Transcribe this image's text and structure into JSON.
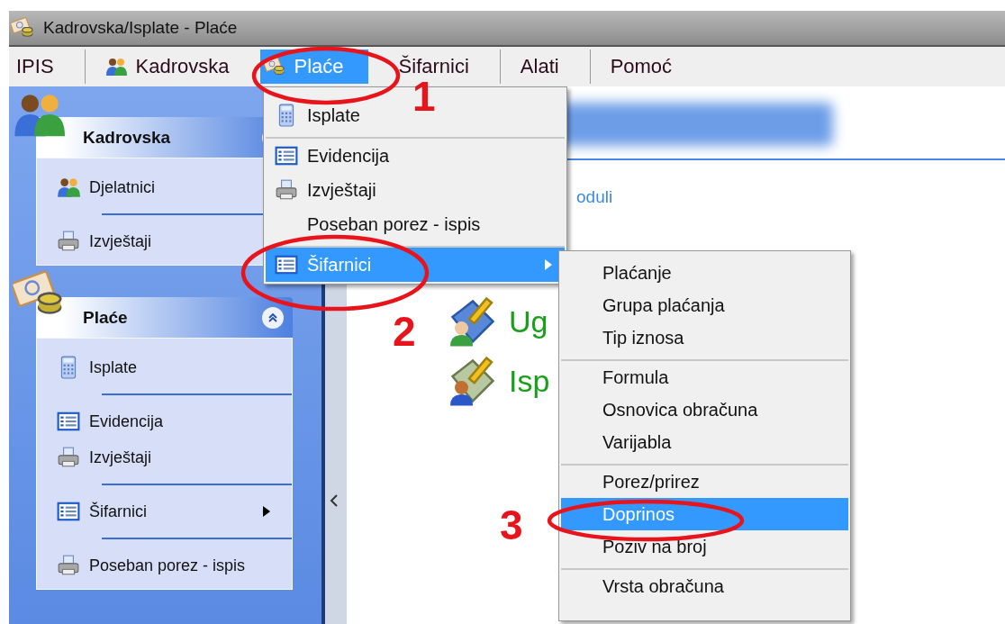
{
  "window": {
    "title": "Kadrovska/Isplate - Plaće"
  },
  "menu_bar": [
    {
      "label": "IPIS",
      "kind": "none",
      "selected": false,
      "separator_before": false
    },
    {
      "label": "Kadrovska",
      "kind": "people",
      "selected": false,
      "separator_before": true
    },
    {
      "label": "Plaće",
      "kind": "money",
      "selected": true,
      "separator_before": false
    },
    {
      "label": "Šifarnici",
      "kind": "none",
      "selected": false,
      "separator_before": false
    },
    {
      "label": "Alati",
      "kind": "none",
      "selected": false,
      "separator_before": true
    },
    {
      "label": "Pomoć",
      "kind": "none",
      "selected": false,
      "separator_before": true
    }
  ],
  "sidebar": {
    "groups": [
      {
        "title": "Kadrovska",
        "kind": "people",
        "expanded": true,
        "items": [
          {
            "label": "Djelatnici",
            "kind": "people",
            "separator_before": false
          },
          {
            "label": "Izvještaji",
            "kind": "printer",
            "separator_before": true
          }
        ]
      },
      {
        "title": "Plaće",
        "kind": "money",
        "expanded": true,
        "items": [
          {
            "label": "Isplate",
            "kind": "calculator",
            "separator_before": false,
            "has_submenu": false
          },
          {
            "label": "Evidencija",
            "kind": "list",
            "separator_before": true,
            "has_submenu": false
          },
          {
            "label": "Izvještaji",
            "kind": "printer",
            "separator_before": false,
            "has_submenu": false
          },
          {
            "label": "Šifarnici",
            "kind": "list",
            "separator_before": true,
            "has_submenu": true
          },
          {
            "label": "Poseban porez - ispis",
            "kind": "printer",
            "separator_before": true,
            "has_submenu": false
          }
        ]
      }
    ]
  },
  "main": {
    "link": "oduli",
    "entries": [
      {
        "label": "Ug",
        "kind": "folder"
      },
      {
        "label": "Isp",
        "kind": "banknote"
      }
    ]
  },
  "dropdown_menu": {
    "items": [
      {
        "label": "Isplate",
        "kind": "calculator",
        "selected": false,
        "separator_before": false,
        "has_submenu": false
      },
      {
        "label": "Evidencija",
        "kind": "list",
        "selected": false,
        "separator_before": true,
        "has_submenu": false
      },
      {
        "label": "Izvještaji",
        "kind": "printer",
        "selected": false,
        "separator_before": false,
        "has_submenu": false
      },
      {
        "label": "Poseban porez - ispis",
        "kind": "none",
        "selected": false,
        "separator_before": false,
        "has_submenu": false
      },
      {
        "label": "Šifarnici",
        "kind": "list",
        "selected": true,
        "separator_before": true,
        "has_submenu": true
      }
    ]
  },
  "submenu": {
    "items": [
      {
        "label": "Plaćanje",
        "selected": false,
        "separator_before": false
      },
      {
        "label": "Grupa plaćanja",
        "selected": false,
        "separator_before": false
      },
      {
        "label": "Tip iznosa",
        "selected": false,
        "separator_before": false
      },
      {
        "label": "Formula",
        "selected": false,
        "separator_before": true
      },
      {
        "label": "Osnovica obračuna",
        "selected": false,
        "separator_before": false
      },
      {
        "label": "Varijabla",
        "selected": false,
        "separator_before": false
      },
      {
        "label": "Porez/prirez",
        "selected": false,
        "separator_before": true
      },
      {
        "label": "Doprinos",
        "selected": true,
        "separator_before": false
      },
      {
        "label": "Poziv na broj",
        "selected": false,
        "separator_before": false
      },
      {
        "label": "Vrsta obračuna",
        "selected": false,
        "separator_before": true
      }
    ]
  },
  "annotations": [
    {
      "label": "1"
    },
    {
      "label": "2"
    },
    {
      "label": "3"
    }
  ]
}
